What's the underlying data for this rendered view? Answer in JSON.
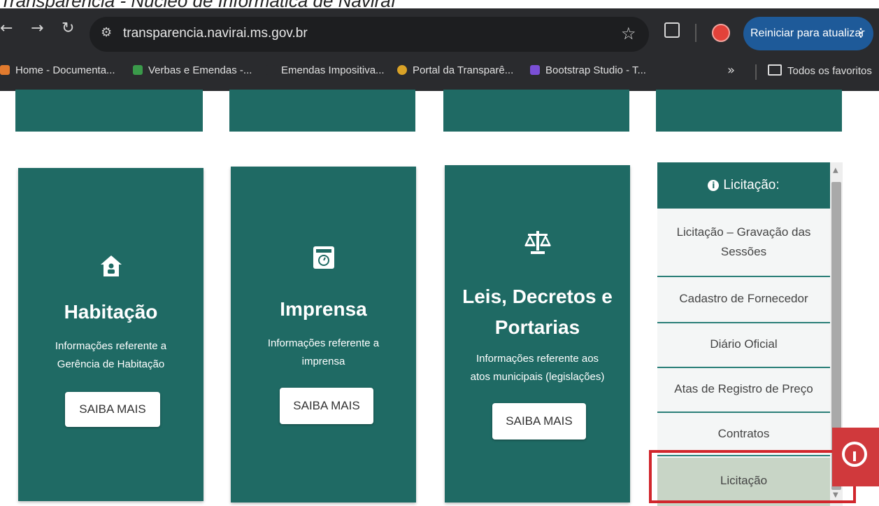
{
  "caption": "Transparência - Núcleo de Informática de Naviraí",
  "browser": {
    "url": "transparencia.navirai.ms.gov.br",
    "update_button": "Reiniciar para atualizar",
    "bookmarks": [
      {
        "label": "Home - Documenta...",
        "color": "#e07a2e"
      },
      {
        "label": "Verbas e Emendas -...",
        "color": "#3a9a4a"
      },
      {
        "label": "Emendas Impositiva...",
        "color": "#2a2b2e"
      },
      {
        "label": "Portal da Transparê...",
        "color": "#d9a227"
      },
      {
        "label": "Bootstrap Studio - T...",
        "color": "#7a4fd6"
      }
    ],
    "all_favorites": "Todos os favoritos"
  },
  "cards": [
    {
      "title": "Habitação",
      "desc_line1": "Informações referente a",
      "desc_line2": "Gerência de Habitação",
      "button": "SAIBA MAIS",
      "icon": "house-icon"
    },
    {
      "title": "Imprensa",
      "desc_line1": "Informações referente a",
      "desc_line2": "imprensa",
      "button": "SAIBA MAIS",
      "icon": "newspaper-icon"
    },
    {
      "title_line1": "Leis, Decretos e",
      "title_line2": "Portarias",
      "desc_line1": "Informações referente aos",
      "desc_line2": "atos municipais (legislações)",
      "button": "SAIBA MAIS",
      "icon": "scales-icon"
    }
  ],
  "panel": {
    "header": "Licitação:",
    "items": [
      {
        "line1": "Licitação – Gravação das",
        "line2": "Sessões"
      },
      {
        "line1": "Cadastro de Fornecedor"
      },
      {
        "line1": "Diário Oficial"
      },
      {
        "line1": "Atas de Registro de Preço"
      },
      {
        "line1": "Contratos"
      },
      {
        "line1": "Licitação"
      }
    ]
  },
  "colors": {
    "teal": "#1f6a64",
    "highlight": "#d1262c"
  }
}
